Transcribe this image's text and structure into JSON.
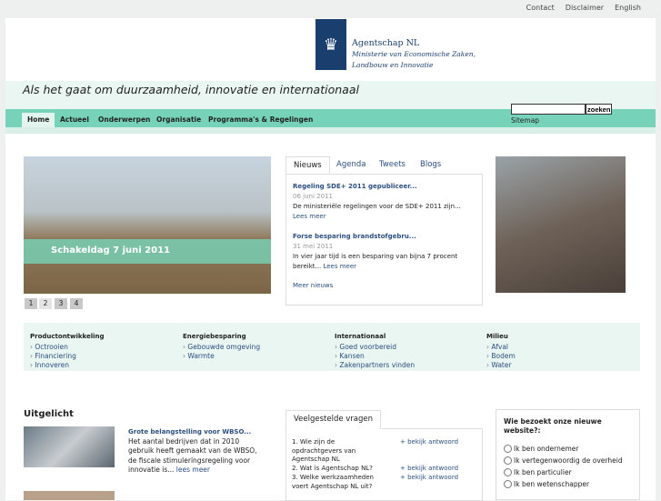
{
  "toplinks": [
    "Contact",
    "Disclaimer",
    "English"
  ],
  "logo": {
    "name": "Agentschap NL",
    "sub1": "Ministerie van Economische Zaken,",
    "sub2": "Landbouw en Innovatie"
  },
  "tagline": "Als het gaat om duurzaamheid, innovatie en internationaal",
  "nav": [
    "Home",
    "Actueel",
    "Onderwerpen",
    "Organisatie",
    "Programma's & Regelingen"
  ],
  "search": {
    "button": "zoeken",
    "sitemap": "Sitemap"
  },
  "slider": {
    "caption": "Schakeldag 7 juni 2011",
    "pages": [
      "1",
      "2",
      "3",
      "4"
    ]
  },
  "tabs": [
    "Nieuws",
    "Agenda",
    "Tweets",
    "Blogs"
  ],
  "news": [
    {
      "title": "Regeling SDE+ 2011 gepubliceer...",
      "date": "06 juni 2011",
      "text": "De ministeriële regelingen voor de SDE+ 2011 zijn...",
      "more": "Lees meer"
    },
    {
      "title": "Forse besparing brandstofgebru...",
      "date": "31 mei 2011",
      "text": "In vier jaar tijd is een besparing van bijna 7 procent bereikt...",
      "more": "Lees meer"
    }
  ],
  "more_news": "Meer nieuws",
  "columns": [
    {
      "title": "Productontwikkeling",
      "links": [
        "Octrooien",
        "Financiering",
        "Innoveren"
      ]
    },
    {
      "title": "Energiebesparing",
      "links": [
        "Gebouwde omgeving",
        "Warmte"
      ]
    },
    {
      "title": "Internationaal",
      "links": [
        "Goed voorbereid",
        "Kansen",
        "Zakenpartners vinden"
      ]
    },
    {
      "title": "Milieu",
      "links": [
        "Afval",
        "Bodem",
        "Water"
      ]
    }
  ],
  "uitgelicht": {
    "heading": "Uitgelicht",
    "title": "Grote belangstelling voor WBSO...",
    "text": "Het aantal bedrijven dat in 2010 gebruik heeft gemaakt van de WBSO, de fiscale stimuleringsregeling voor innovatie is...",
    "more": "lees meer"
  },
  "faq": {
    "tab": "Veelgestelde vragen",
    "answer": "+ bekijk antwoord",
    "questions": [
      "1. Wie zijn de opdrachtgevers van Agentschap NL",
      "2. Wat is Agentschap NL?",
      "3. Welke werkzaamheden voert Agentschap NL uit?"
    ]
  },
  "poll": {
    "question": "Wie bezoekt onze nieuwe website?:",
    "options": [
      "Ik ben ondernemer",
      "Ik vertegenwoordig de overheid",
      "Ik ben particulier",
      "Ik ben wetenschapper"
    ]
  }
}
